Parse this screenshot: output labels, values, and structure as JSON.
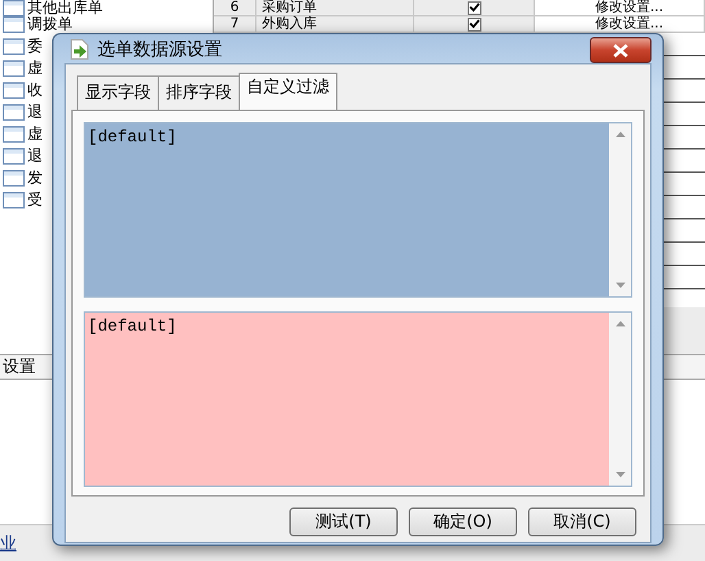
{
  "background": {
    "tree_items": [
      {
        "label": "其他出库单"
      },
      {
        "label": "调拨单"
      },
      {
        "label": "委"
      },
      {
        "label": "虚"
      },
      {
        "label": "收"
      },
      {
        "label": "退"
      },
      {
        "label": "虚"
      },
      {
        "label": "退"
      },
      {
        "label": "发"
      },
      {
        "label": "受"
      }
    ],
    "table_rows": [
      {
        "number": "6",
        "name": "采购订单",
        "checked": true,
        "action": "修改设置..."
      },
      {
        "number": "7",
        "name": "外购入库",
        "checked": true,
        "action": "修改设置..."
      }
    ],
    "section_label": "设置",
    "footer_link": "业"
  },
  "dialog": {
    "title": "选单数据源设置",
    "tabs": [
      {
        "label": "显示字段",
        "selected": false
      },
      {
        "label": "排序字段",
        "selected": false
      },
      {
        "label": "自定义过滤",
        "selected": true
      }
    ],
    "upper_text": "[default]",
    "lower_text": "[default]",
    "buttons": [
      {
        "label": "测试(T)"
      },
      {
        "label": "确定(O)"
      },
      {
        "label": "取消(C)"
      }
    ]
  }
}
